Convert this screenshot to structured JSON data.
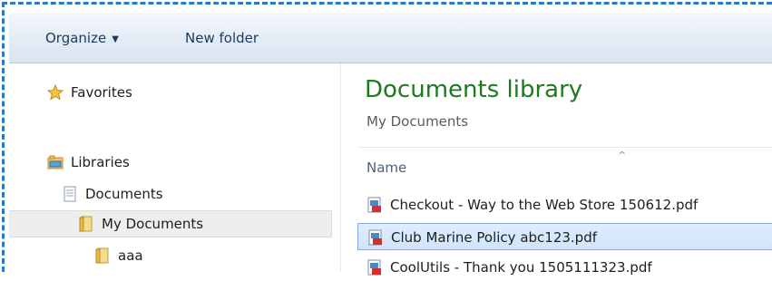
{
  "toolbar": {
    "organize_label": "Organize",
    "new_folder_label": "New folder"
  },
  "nav": {
    "favorites": "Favorites",
    "libraries": "Libraries",
    "documents": "Documents",
    "my_documents": "My Documents",
    "aaa": "aaa"
  },
  "content": {
    "title": "Documents library",
    "subtitle": "My Documents",
    "column_name": "Name",
    "files": [
      {
        "name": "Checkout - Way to the Web Store 150612.pdf",
        "icon": "pdf-icon",
        "selected": false
      },
      {
        "name": "Club Marine Policy abc123.pdf",
        "icon": "pdf-icon",
        "selected": true
      },
      {
        "name": "CoolUtils - Thank you 1505111323.pdf",
        "icon": "pdf-icon",
        "selected": false
      }
    ]
  },
  "colors": {
    "accent_green": "#1e7a1e",
    "selection_blue": "#cfe4fb",
    "frame_dashed": "#2a78c8"
  },
  "icons": [
    "star-icon",
    "library-icon",
    "document-icon",
    "folder-icon",
    "pdf-icon",
    "chevron-down-icon",
    "sort-up-icon"
  ]
}
